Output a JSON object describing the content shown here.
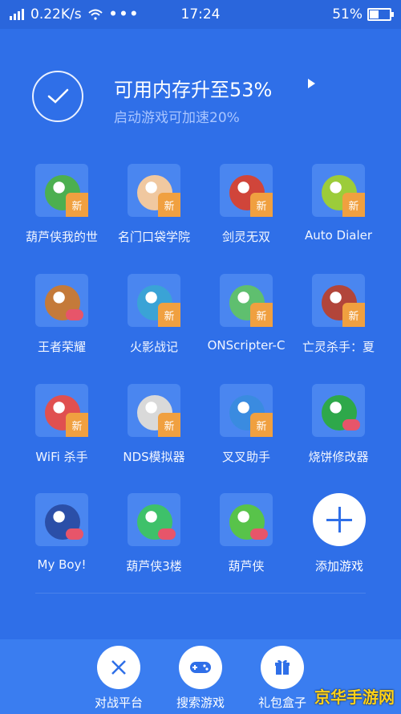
{
  "status_bar": {
    "speed": "0.22K/s",
    "more": "•••",
    "time": "17:24",
    "battery_text": "51%",
    "battery_level": 0.51
  },
  "boost": {
    "title": "可用内存升至53%",
    "subtitle": "启动游戏可加速20%"
  },
  "apps": [
    {
      "label": "葫芦侠我的世",
      "badge": "新",
      "icon": "minecraft-gourd-icon",
      "color": "#4caf50"
    },
    {
      "label": "名门口袋学院",
      "badge": "新",
      "icon": "academy-game-icon",
      "color": "#f0c8a0"
    },
    {
      "label": "剑灵无双",
      "badge": "新",
      "icon": "sword-spirit-icon",
      "color": "#d0453a"
    },
    {
      "label": "Auto Dialer",
      "badge": "新",
      "icon": "android-icon",
      "color": "#9ccc3a"
    },
    {
      "label": "王者荣耀",
      "badge": "",
      "icon": "honor-of-kings-icon",
      "color": "#c47a3a"
    },
    {
      "label": "火影战记",
      "badge": "新",
      "icon": "naruto-game-icon",
      "color": "#3aa3d6"
    },
    {
      "label": "ONScripter-C",
      "badge": "新",
      "icon": "onscripter-icon",
      "color": "#5fbf6f"
    },
    {
      "label": "亡灵杀手：夏",
      "badge": "新",
      "icon": "undead-slayer-icon",
      "color": "#b2453a"
    },
    {
      "label": "WiFi 杀手",
      "badge": "新",
      "icon": "wifi-killer-icon",
      "color": "#e05050"
    },
    {
      "label": "NDS模拟器",
      "badge": "新",
      "icon": "nds-emulator-icon",
      "color": "#d9d9d9"
    },
    {
      "label": "叉叉助手",
      "badge": "新",
      "icon": "chacha-helper-icon",
      "color": "#3a8be0"
    },
    {
      "label": "烧饼修改器",
      "badge": "",
      "icon": "wrench-modifier-icon",
      "color": "#2ea84a"
    },
    {
      "label": "My Boy!",
      "badge": "",
      "icon": "gba-emulator-icon",
      "color": "#2b4fa8"
    },
    {
      "label": "葫芦侠3楼",
      "badge": "",
      "icon": "gourd-3f-icon",
      "color": "#3ec16a"
    },
    {
      "label": "葫芦侠",
      "badge": "",
      "icon": "gourd-icon",
      "color": "#58c34a"
    }
  ],
  "add_game": {
    "label": "添加游戏"
  },
  "bottom_nav": [
    {
      "label": "对战平台",
      "icon": "crossed-swords-icon"
    },
    {
      "label": "搜索游戏",
      "icon": "gamepad-icon"
    },
    {
      "label": "礼包盒子",
      "icon": "gift-icon"
    }
  ],
  "watermark": "京华手游网",
  "colors": {
    "background": "#2f6fe8",
    "badge": "#f0a040",
    "bottom_bar": "#3a7df0"
  }
}
